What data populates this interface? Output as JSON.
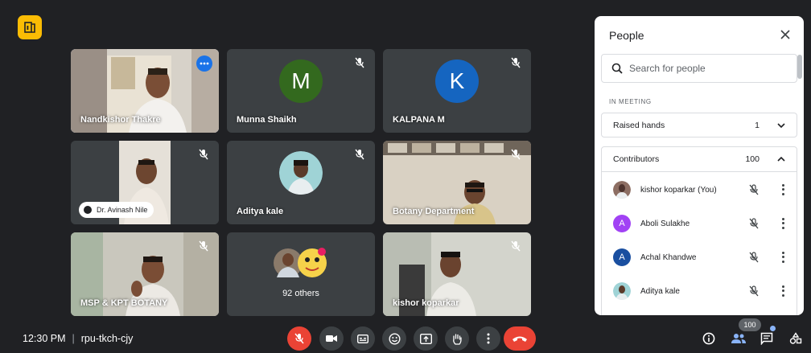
{
  "meeting": {
    "time": "12:30 PM",
    "separator": "|",
    "code": "rpu-tkch-cjy"
  },
  "tiles": [
    {
      "name": "Nandkishor Thakre",
      "type": "video",
      "active": true
    },
    {
      "name": "Munna Shaikh",
      "type": "avatar",
      "initial": "M",
      "color": "#33691e"
    },
    {
      "name": "KALPANA M",
      "type": "avatar",
      "initial": "K",
      "color": "#1565c0"
    },
    {
      "name": "Dr. Avinash Nile",
      "type": "video"
    },
    {
      "name": "Aditya kale",
      "type": "photo"
    },
    {
      "name": "Botany Department",
      "type": "video"
    },
    {
      "name": "MSP & KPT BOTANY",
      "type": "video"
    },
    {
      "name": "92 others",
      "type": "group"
    },
    {
      "name": "kishor koparkar",
      "type": "video"
    }
  ],
  "panel": {
    "title": "People",
    "search_placeholder": "Search for people",
    "section_label": "IN MEETING",
    "raised_hands": {
      "label": "Raised hands",
      "count": "1"
    },
    "contributors": {
      "label": "Contributors",
      "count": "100"
    },
    "people": [
      {
        "name": "kishor koparkar (You)",
        "initial": "",
        "color": "#795548"
      },
      {
        "name": "Aboli Sulakhe",
        "initial": "A",
        "color": "#a142f4"
      },
      {
        "name": "Achal Khandwe",
        "initial": "A",
        "color": "#1a4fa0"
      },
      {
        "name": "Aditya kale",
        "initial": "",
        "color": "#80cbc4"
      }
    ]
  },
  "toolbar": {
    "participant_count": "100"
  },
  "colors": {
    "accent": "#8ab4f8",
    "end_call": "#ea4335",
    "bg": "#202124",
    "tile": "#3c4043"
  }
}
